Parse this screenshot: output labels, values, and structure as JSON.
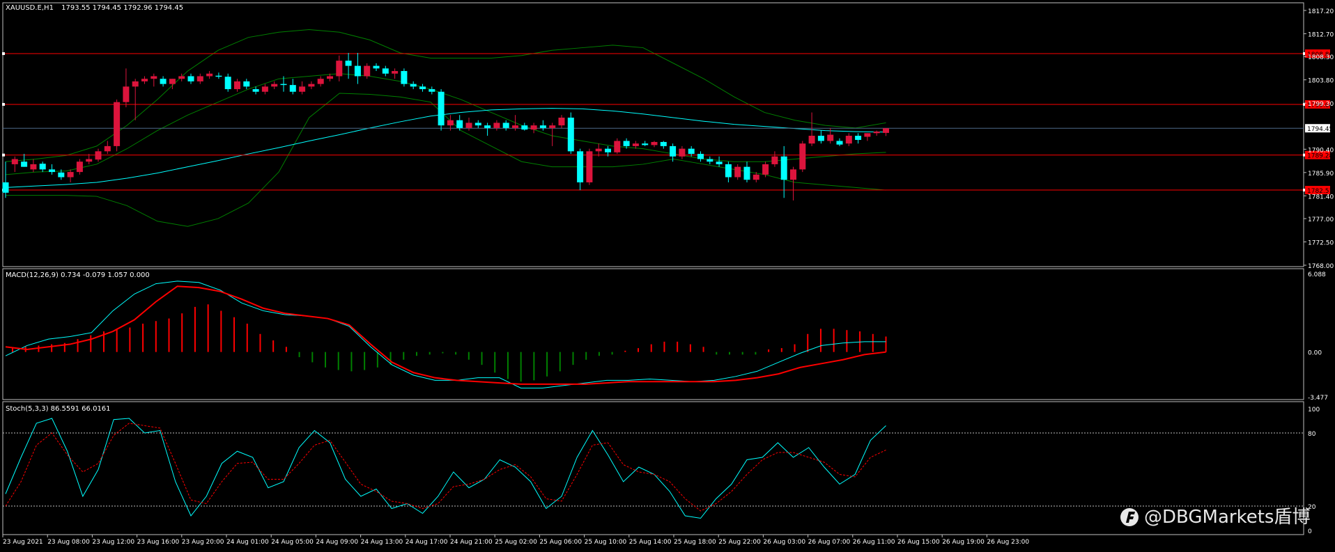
{
  "header": {
    "symbol_tf": "XAUUSD.E,H1",
    "ohlc": "1793.55 1794.45 1792.96 1794.45"
  },
  "watermark": "@DBGMarkets盾博",
  "colors": {
    "background": "#000000",
    "frame": "#c0c0c0",
    "bull_candle": "#dc143c",
    "bear_candle": "#00ffff",
    "bollinger": "#008000",
    "moving_average": "#00ffff",
    "horizontal_lines": "#ff0000",
    "bid_line": "#4f6a8a",
    "macd_line": "#00ffff",
    "macd_signal": "#ff0000",
    "histogram_positive": "#ff0000",
    "histogram_negative": "#008000",
    "stoch_main": "#00ffff",
    "stoch_signal": "#ff0000"
  },
  "chart_data": [
    {
      "type": "candlestick",
      "name": "XAUUSD.E,H1",
      "price_ticks": [
        "1817.20",
        "1812.70",
        "1808.30",
        "1803.80",
        "1799.30",
        "1794.45",
        "1790.40",
        "1785.90",
        "1781.40",
        "1777.00",
        "1772.50",
        "1768.00"
      ],
      "ylim": [
        1768.0,
        1817.2
      ],
      "time_labels": [
        "23 Aug 2021",
        "23 Aug 08:00",
        "23 Aug 12:00",
        "23 Aug 16:00",
        "23 Aug 20:00",
        "24 Aug 01:00",
        "24 Aug 05:00",
        "24 Aug 09:00",
        "24 Aug 13:00",
        "24 Aug 17:00",
        "24 Aug 21:00",
        "25 Aug 02:00",
        "25 Aug 06:00",
        "25 Aug 10:00",
        "25 Aug 14:00",
        "25 Aug 18:00",
        "25 Aug 22:00",
        "26 Aug 03:00",
        "26 Aug 07:00",
        "26 Aug 11:00",
        "26 Aug 15:00",
        "26 Aug 19:00",
        "26 Aug 23:00"
      ],
      "candles": [
        {
          "o": 1784.0,
          "h": 1788.0,
          "l": 1781.0,
          "c": 1782.0
        },
        {
          "o": 1787.5,
          "h": 1789.0,
          "l": 1786.0,
          "c": 1788.5
        },
        {
          "o": 1788.0,
          "h": 1789.5,
          "l": 1787.0,
          "c": 1787.0
        },
        {
          "o": 1786.5,
          "h": 1788.5,
          "l": 1786.0,
          "c": 1787.5
        },
        {
          "o": 1787.6,
          "h": 1788.0,
          "l": 1786.0,
          "c": 1786.5
        },
        {
          "o": 1786.5,
          "h": 1787.5,
          "l": 1785.5,
          "c": 1786.0
        },
        {
          "o": 1785.9,
          "h": 1786.5,
          "l": 1784.5,
          "c": 1785.0
        },
        {
          "o": 1785.0,
          "h": 1786.5,
          "l": 1784.0,
          "c": 1786.0
        },
        {
          "o": 1786.0,
          "h": 1788.5,
          "l": 1785.5,
          "c": 1788.0
        },
        {
          "o": 1788.0,
          "h": 1789.5,
          "l": 1787.5,
          "c": 1788.5
        },
        {
          "o": 1788.4,
          "h": 1790.5,
          "l": 1788.0,
          "c": 1790.0
        },
        {
          "o": 1790.0,
          "h": 1792.0,
          "l": 1789.5,
          "c": 1791.0
        },
        {
          "o": 1791.0,
          "h": 1800.0,
          "l": 1790.0,
          "c": 1799.5
        },
        {
          "o": 1799.5,
          "h": 1806.0,
          "l": 1798.5,
          "c": 1802.5
        },
        {
          "o": 1802.5,
          "h": 1804.0,
          "l": 1796.0,
          "c": 1803.5
        },
        {
          "o": 1803.5,
          "h": 1804.5,
          "l": 1803.0,
          "c": 1804.0
        },
        {
          "o": 1804.0,
          "h": 1805.0,
          "l": 1802.5,
          "c": 1804.5
        },
        {
          "o": 1804.0,
          "h": 1804.5,
          "l": 1802.5,
          "c": 1803.0
        },
        {
          "o": 1803.0,
          "h": 1804.0,
          "l": 1802.0,
          "c": 1804.0
        },
        {
          "o": 1804.0,
          "h": 1805.0,
          "l": 1803.5,
          "c": 1804.5
        },
        {
          "o": 1804.5,
          "h": 1805.0,
          "l": 1803.0,
          "c": 1803.5
        },
        {
          "o": 1803.5,
          "h": 1805.0,
          "l": 1803.0,
          "c": 1804.5
        },
        {
          "o": 1804.5,
          "h": 1805.5,
          "l": 1804.0,
          "c": 1805.0
        },
        {
          "o": 1804.6,
          "h": 1805.2,
          "l": 1804.0,
          "c": 1804.4
        },
        {
          "o": 1804.4,
          "h": 1805.0,
          "l": 1801.5,
          "c": 1802.0
        },
        {
          "o": 1802.0,
          "h": 1804.0,
          "l": 1801.5,
          "c": 1803.5
        },
        {
          "o": 1803.5,
          "h": 1804.0,
          "l": 1802.0,
          "c": 1802.5
        },
        {
          "o": 1802.0,
          "h": 1802.5,
          "l": 1801.0,
          "c": 1801.5
        },
        {
          "o": 1801.5,
          "h": 1803.0,
          "l": 1801.0,
          "c": 1802.5
        },
        {
          "o": 1802.5,
          "h": 1803.5,
          "l": 1802.0,
          "c": 1803.0
        },
        {
          "o": 1803.0,
          "h": 1804.5,
          "l": 1801.5,
          "c": 1802.8
        },
        {
          "o": 1802.8,
          "h": 1804.0,
          "l": 1801.0,
          "c": 1801.5
        },
        {
          "o": 1801.5,
          "h": 1803.5,
          "l": 1801.0,
          "c": 1802.5
        },
        {
          "o": 1802.5,
          "h": 1803.5,
          "l": 1802.0,
          "c": 1803.0
        },
        {
          "o": 1803.0,
          "h": 1804.5,
          "l": 1802.5,
          "c": 1804.0
        },
        {
          "o": 1804.0,
          "h": 1805.0,
          "l": 1803.5,
          "c": 1804.5
        },
        {
          "o": 1804.5,
          "h": 1808.5,
          "l": 1803.5,
          "c": 1807.5
        },
        {
          "o": 1807.5,
          "h": 1809.0,
          "l": 1804.0,
          "c": 1806.5
        },
        {
          "o": 1806.5,
          "h": 1809.0,
          "l": 1803.0,
          "c": 1804.5
        },
        {
          "o": 1804.5,
          "h": 1807.0,
          "l": 1804.0,
          "c": 1806.5
        },
        {
          "o": 1806.5,
          "h": 1807.0,
          "l": 1805.5,
          "c": 1806.0
        },
        {
          "o": 1806.0,
          "h": 1806.5,
          "l": 1804.5,
          "c": 1805.0
        },
        {
          "o": 1805.0,
          "h": 1806.0,
          "l": 1804.0,
          "c": 1805.5
        },
        {
          "o": 1805.5,
          "h": 1806.0,
          "l": 1802.5,
          "c": 1803.0
        },
        {
          "o": 1803.0,
          "h": 1803.5,
          "l": 1802.0,
          "c": 1802.5
        },
        {
          "o": 1802.5,
          "h": 1803.0,
          "l": 1801.5,
          "c": 1802.0
        },
        {
          "o": 1802.0,
          "h": 1802.5,
          "l": 1801.0,
          "c": 1801.5
        },
        {
          "o": 1801.5,
          "h": 1802.0,
          "l": 1794.0,
          "c": 1795.0
        },
        {
          "o": 1795.0,
          "h": 1797.0,
          "l": 1794.0,
          "c": 1796.0
        },
        {
          "o": 1796.0,
          "h": 1797.0,
          "l": 1794.0,
          "c": 1794.5
        },
        {
          "o": 1794.5,
          "h": 1796.5,
          "l": 1794.0,
          "c": 1795.5
        },
        {
          "o": 1795.5,
          "h": 1796.0,
          "l": 1794.5,
          "c": 1795.0
        },
        {
          "o": 1795.0,
          "h": 1795.5,
          "l": 1793.0,
          "c": 1794.5
        },
        {
          "o": 1794.5,
          "h": 1796.0,
          "l": 1794.0,
          "c": 1795.5
        },
        {
          "o": 1795.5,
          "h": 1796.0,
          "l": 1794.0,
          "c": 1794.5
        },
        {
          "o": 1794.5,
          "h": 1797.0,
          "l": 1794.0,
          "c": 1795.0
        },
        {
          "o": 1795.0,
          "h": 1795.5,
          "l": 1794.0,
          "c": 1794.2
        },
        {
          "o": 1794.2,
          "h": 1795.5,
          "l": 1793.5,
          "c": 1795.0
        },
        {
          "o": 1795.0,
          "h": 1796.0,
          "l": 1794.0,
          "c": 1794.5
        },
        {
          "o": 1794.5,
          "h": 1795.5,
          "l": 1791.0,
          "c": 1795.0
        },
        {
          "o": 1795.0,
          "h": 1797.0,
          "l": 1794.5,
          "c": 1796.5
        },
        {
          "o": 1796.5,
          "h": 1797.5,
          "l": 1789.5,
          "c": 1790.0
        },
        {
          "o": 1790.0,
          "h": 1790.5,
          "l": 1782.5,
          "c": 1784.0
        },
        {
          "o": 1784.0,
          "h": 1790.5,
          "l": 1783.5,
          "c": 1790.0
        },
        {
          "o": 1790.0,
          "h": 1791.5,
          "l": 1789.0,
          "c": 1790.5
        },
        {
          "o": 1790.5,
          "h": 1791.0,
          "l": 1789.0,
          "c": 1789.8
        },
        {
          "o": 1789.8,
          "h": 1792.5,
          "l": 1789.5,
          "c": 1792.0
        },
        {
          "o": 1792.0,
          "h": 1792.5,
          "l": 1790.5,
          "c": 1791.0
        },
        {
          "o": 1791.0,
          "h": 1792.0,
          "l": 1790.5,
          "c": 1791.5
        },
        {
          "o": 1791.5,
          "h": 1792.0,
          "l": 1791.0,
          "c": 1791.2
        },
        {
          "o": 1791.2,
          "h": 1792.0,
          "l": 1790.8,
          "c": 1791.8
        },
        {
          "o": 1791.8,
          "h": 1792.0,
          "l": 1790.5,
          "c": 1791.0
        },
        {
          "o": 1791.0,
          "h": 1791.5,
          "l": 1788.0,
          "c": 1789.0
        },
        {
          "o": 1789.0,
          "h": 1791.0,
          "l": 1788.5,
          "c": 1790.5
        },
        {
          "o": 1790.5,
          "h": 1791.0,
          "l": 1789.0,
          "c": 1789.5
        },
        {
          "o": 1789.5,
          "h": 1790.0,
          "l": 1788.0,
          "c": 1788.5
        },
        {
          "o": 1788.5,
          "h": 1789.0,
          "l": 1787.5,
          "c": 1788.0
        },
        {
          "o": 1788.0,
          "h": 1789.0,
          "l": 1787.0,
          "c": 1787.5
        },
        {
          "o": 1787.5,
          "h": 1788.0,
          "l": 1784.0,
          "c": 1785.0
        },
        {
          "o": 1785.0,
          "h": 1787.5,
          "l": 1784.5,
          "c": 1787.0
        },
        {
          "o": 1787.0,
          "h": 1788.0,
          "l": 1784.0,
          "c": 1784.5
        },
        {
          "o": 1784.5,
          "h": 1786.0,
          "l": 1784.0,
          "c": 1785.5
        },
        {
          "o": 1785.5,
          "h": 1788.0,
          "l": 1785.0,
          "c": 1787.5
        },
        {
          "o": 1787.5,
          "h": 1790.0,
          "l": 1787.0,
          "c": 1789.0
        },
        {
          "o": 1789.0,
          "h": 1791.0,
          "l": 1781.0,
          "c": 1784.5
        },
        {
          "o": 1784.5,
          "h": 1787.0,
          "l": 1780.5,
          "c": 1786.5
        },
        {
          "o": 1786.5,
          "h": 1792.0,
          "l": 1786.0,
          "c": 1791.5
        },
        {
          "o": 1791.5,
          "h": 1797.5,
          "l": 1791.0,
          "c": 1793.0
        },
        {
          "o": 1793.0,
          "h": 1794.0,
          "l": 1791.5,
          "c": 1792.0
        },
        {
          "o": 1792.0,
          "h": 1794.5,
          "l": 1791.5,
          "c": 1793.2
        },
        {
          "o": 1792.0,
          "h": 1792.5,
          "l": 1791.0,
          "c": 1791.3
        },
        {
          "o": 1791.5,
          "h": 1793.5,
          "l": 1791.0,
          "c": 1793.0
        },
        {
          "o": 1793.0,
          "h": 1793.5,
          "l": 1791.5,
          "c": 1792.2
        },
        {
          "o": 1792.8,
          "h": 1793.5,
          "l": 1792.0,
          "c": 1793.5
        },
        {
          "o": 1793.5,
          "h": 1794.0,
          "l": 1793.0,
          "c": 1793.8
        },
        {
          "o": 1793.55,
          "h": 1794.45,
          "l": 1792.96,
          "c": 1794.45
        }
      ],
      "bollinger_upper": [
        1788.0,
        1788.5,
        1789.2,
        1791.0,
        1795.0,
        1800.0,
        1805.5,
        1809.5,
        1812.0,
        1813.0,
        1813.5,
        1813.0,
        1811.5,
        1809.0,
        1808.0,
        1808.0,
        1808.0,
        1808.5,
        1809.5,
        1810.0,
        1810.5,
        1810.0,
        1807.0,
        1804.0,
        1800.5,
        1797.5,
        1796.0,
        1795.0,
        1794.5,
        1795.5
      ],
      "bollinger_lower": [
        1781.5,
        1781.5,
        1781.5,
        1781.3,
        1779.5,
        1776.5,
        1775.5,
        1777.0,
        1780.0,
        1786.0,
        1796.5,
        1801.2,
        1801.0,
        1800.5,
        1799.5,
        1794.0,
        1791.0,
        1788.0,
        1787.0,
        1787.0,
        1787.0,
        1787.5,
        1788.5,
        1787.5,
        1786.5,
        1785.5,
        1784.0,
        1783.5,
        1783.0,
        1782.5
      ],
      "bollinger_middle": [
        1785.5,
        1786.0,
        1786.2,
        1787.5,
        1790.5,
        1794.0,
        1797.0,
        1799.5,
        1802.0,
        1804.0,
        1804.5,
        1805.0,
        1804.5,
        1803.5,
        1802.0,
        1800.0,
        1797.5,
        1795.0,
        1793.0,
        1792.0,
        1791.0,
        1790.5,
        1789.5,
        1788.5,
        1788.0,
        1788.0,
        1788.5,
        1789.0,
        1789.5,
        1789.8
      ],
      "moving_average": [
        1783.0,
        1783.3,
        1783.6,
        1784.0,
        1784.8,
        1785.8,
        1787.0,
        1788.2,
        1789.5,
        1790.7,
        1792.0,
        1793.2,
        1794.5,
        1795.7,
        1796.8,
        1797.5,
        1798.0,
        1798.2,
        1798.3,
        1798.2,
        1797.8,
        1797.2,
        1796.5,
        1795.8,
        1795.2,
        1794.8,
        1794.4,
        1794.0,
        1793.8,
        1793.7
      ],
      "horizontal_lines": [
        {
          "price": 1808.86,
          "label": "1808.86"
        },
        {
          "price": 1799.06,
          "label": "1799.06"
        },
        {
          "price": 1789.28,
          "label": "1789.28"
        },
        {
          "price": 1782.51,
          "label": "1782.51"
        }
      ],
      "bid_line": {
        "price": 1794.45,
        "label": "1794.45"
      },
      "grid": false
    },
    {
      "type": "line",
      "name": "MACD",
      "header": "MACD(12,26,9) 0.734 -0.079 1.057 0.000",
      "tick_labels": [
        "6.088",
        "0.00",
        "-3.477"
      ],
      "ylim": [
        -3.477,
        6.088
      ],
      "macd_line": [
        -0.3,
        0.5,
        1.0,
        1.2,
        1.5,
        3.2,
        4.5,
        5.3,
        5.5,
        5.4,
        4.8,
        3.8,
        3.2,
        2.9,
        2.8,
        2.6,
        2.0,
        0.4,
        -1.0,
        -1.8,
        -2.2,
        -2.2,
        -2.0,
        -2.0,
        -2.8,
        -2.8,
        -2.6,
        -2.4,
        -2.2,
        -2.2,
        -2.1,
        -2.2,
        -2.3,
        -2.2,
        -1.9,
        -1.5,
        -0.8,
        -0.1,
        0.5,
        0.7,
        0.8,
        0.8
      ],
      "signal_line": [
        0.4,
        0.2,
        0.4,
        0.6,
        1.0,
        1.6,
        2.5,
        3.9,
        5.1,
        5.0,
        4.7,
        4.1,
        3.4,
        3.0,
        2.8,
        2.6,
        2.1,
        0.6,
        -0.8,
        -1.6,
        -2.0,
        -2.2,
        -2.3,
        -2.4,
        -2.5,
        -2.5,
        -2.5,
        -2.5,
        -2.4,
        -2.3,
        -2.3,
        -2.3,
        -2.3,
        -2.3,
        -2.2,
        -2.0,
        -1.7,
        -1.2,
        -0.9,
        -0.6,
        -0.2,
        0.0
      ],
      "histogram": [
        0.3,
        0.4,
        0.5,
        0.6,
        0.7,
        1.0,
        1.3,
        1.6,
        1.8,
        1.9,
        2.2,
        2.4,
        2.6,
        3.0,
        3.5,
        3.7,
        3.2,
        2.7,
        2.2,
        1.4,
        0.9,
        0.4,
        -0.4,
        -0.8,
        -1.2,
        -1.4,
        -1.5,
        -1.4,
        -1.2,
        -1.0,
        -0.6,
        -0.3,
        -0.2,
        -0.1,
        -0.2,
        -0.6,
        -1.0,
        -1.6,
        -2.1,
        -2.3,
        -2.2,
        -1.9,
        -1.5,
        -1.0,
        -0.6,
        -0.3,
        -0.2,
        0.1,
        0.3,
        0.6,
        0.8,
        0.8,
        0.6,
        0.4,
        -0.2,
        -0.2,
        -0.2,
        -0.2,
        0.2,
        0.3,
        0.6,
        1.4,
        1.8,
        1.8,
        1.7,
        1.6,
        1.4,
        1.2
      ],
      "grid": false
    },
    {
      "type": "line",
      "name": "Stochastic",
      "header": "Stoch(5,3,3) 86.5591 66.0161",
      "tick_labels": [
        "100",
        "80",
        "20",
        "0"
      ],
      "ylim": [
        0,
        100
      ],
      "levels": [
        80,
        20
      ],
      "main": [
        30,
        60,
        88,
        92,
        65,
        28,
        50,
        91,
        92,
        80,
        82,
        40,
        12,
        28,
        55,
        65,
        60,
        35,
        40,
        68,
        82,
        72,
        42,
        28,
        34,
        18,
        22,
        14,
        28,
        48,
        35,
        42,
        58,
        52,
        40,
        18,
        28,
        60,
        82,
        62,
        40,
        52,
        46,
        32,
        12,
        10,
        26,
        38,
        58,
        60,
        72,
        60,
        68,
        52,
        38,
        46,
        74,
        86
      ],
      "signal": [
        20,
        40,
        70,
        80,
        62,
        48,
        55,
        78,
        88,
        86,
        84,
        55,
        25,
        22,
        40,
        55,
        56,
        42,
        42,
        55,
        70,
        74,
        56,
        38,
        32,
        24,
        22,
        18,
        22,
        36,
        38,
        42,
        50,
        54,
        44,
        26,
        24,
        46,
        70,
        72,
        54,
        48,
        46,
        40,
        26,
        16,
        22,
        32,
        46,
        58,
        64,
        64,
        60,
        56,
        46,
        44,
        60,
        66
      ],
      "grid": false
    }
  ],
  "layout_note": ""
}
